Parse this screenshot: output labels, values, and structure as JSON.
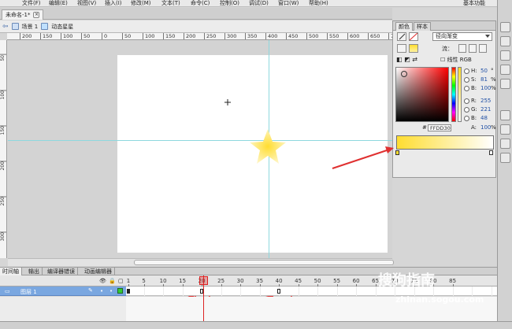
{
  "menubar": {
    "items": [
      "文件(F)",
      "编辑(E)",
      "视图(V)",
      "插入(I)",
      "修改(M)",
      "文本(T)",
      "命令(C)",
      "控制(O)",
      "调试(D)",
      "窗口(W)",
      "帮助(H)"
    ],
    "workspace": "基本功能"
  },
  "document": {
    "tab_label": "未命名-1*",
    "close_glyph": "×"
  },
  "breadcrumb": {
    "scene": "场景 1",
    "symbol": "动态星星"
  },
  "ruler": {
    "h_ticks": [
      "200",
      "150",
      "100",
      "50",
      "0",
      "50",
      "100",
      "150",
      "200",
      "250",
      "300",
      "350",
      "400",
      "450",
      "500",
      "550",
      "600",
      "650",
      "700",
      "750"
    ],
    "v_ticks": [
      "50",
      "100",
      "150",
      "200",
      "250",
      "300",
      "350"
    ]
  },
  "color_panel": {
    "tabs": [
      "颜色",
      "样本"
    ],
    "type_label": "径向渐变",
    "flow_label": "流：",
    "linear_rgb_label": "线性 RGB",
    "fields": [
      {
        "label": "H:",
        "value": "50",
        "unit": "°"
      },
      {
        "label": "S:",
        "value": "81",
        "unit": "%"
      },
      {
        "label": "B:",
        "value": "100",
        "unit": "%"
      },
      {
        "label": "R:",
        "value": "255",
        "unit": ""
      },
      {
        "label": "G:",
        "value": "221",
        "unit": ""
      },
      {
        "label": "B:",
        "value": "48",
        "unit": ""
      }
    ],
    "hex_label": "#",
    "hex_value": "FFDD30",
    "alpha_label": "A:",
    "alpha_value": "100",
    "alpha_unit": "%",
    "gradient_start": "#ffdd30",
    "gradient_end": "#ffffff"
  },
  "timeline": {
    "tabs": [
      "时间轴",
      "输出",
      "编译器错误",
      "动画编辑器"
    ],
    "frame_numbers": [
      "1",
      "5",
      "10",
      "15",
      "20",
      "25",
      "30",
      "35",
      "40",
      "45",
      "50",
      "55",
      "60",
      "65",
      "70",
      "75",
      "80",
      "85"
    ],
    "layer_name": "图层 1",
    "current_frame": 20,
    "keyframes": [
      1,
      20,
      40
    ]
  },
  "watermark": {
    "brand": "搜狗指南",
    "url": "zhinan.sogou.com"
  },
  "colors": {
    "star": "#ffdd30",
    "guide": "#8ed8de",
    "annotation": "#e03030",
    "layer_row": "#7aa7e0"
  }
}
